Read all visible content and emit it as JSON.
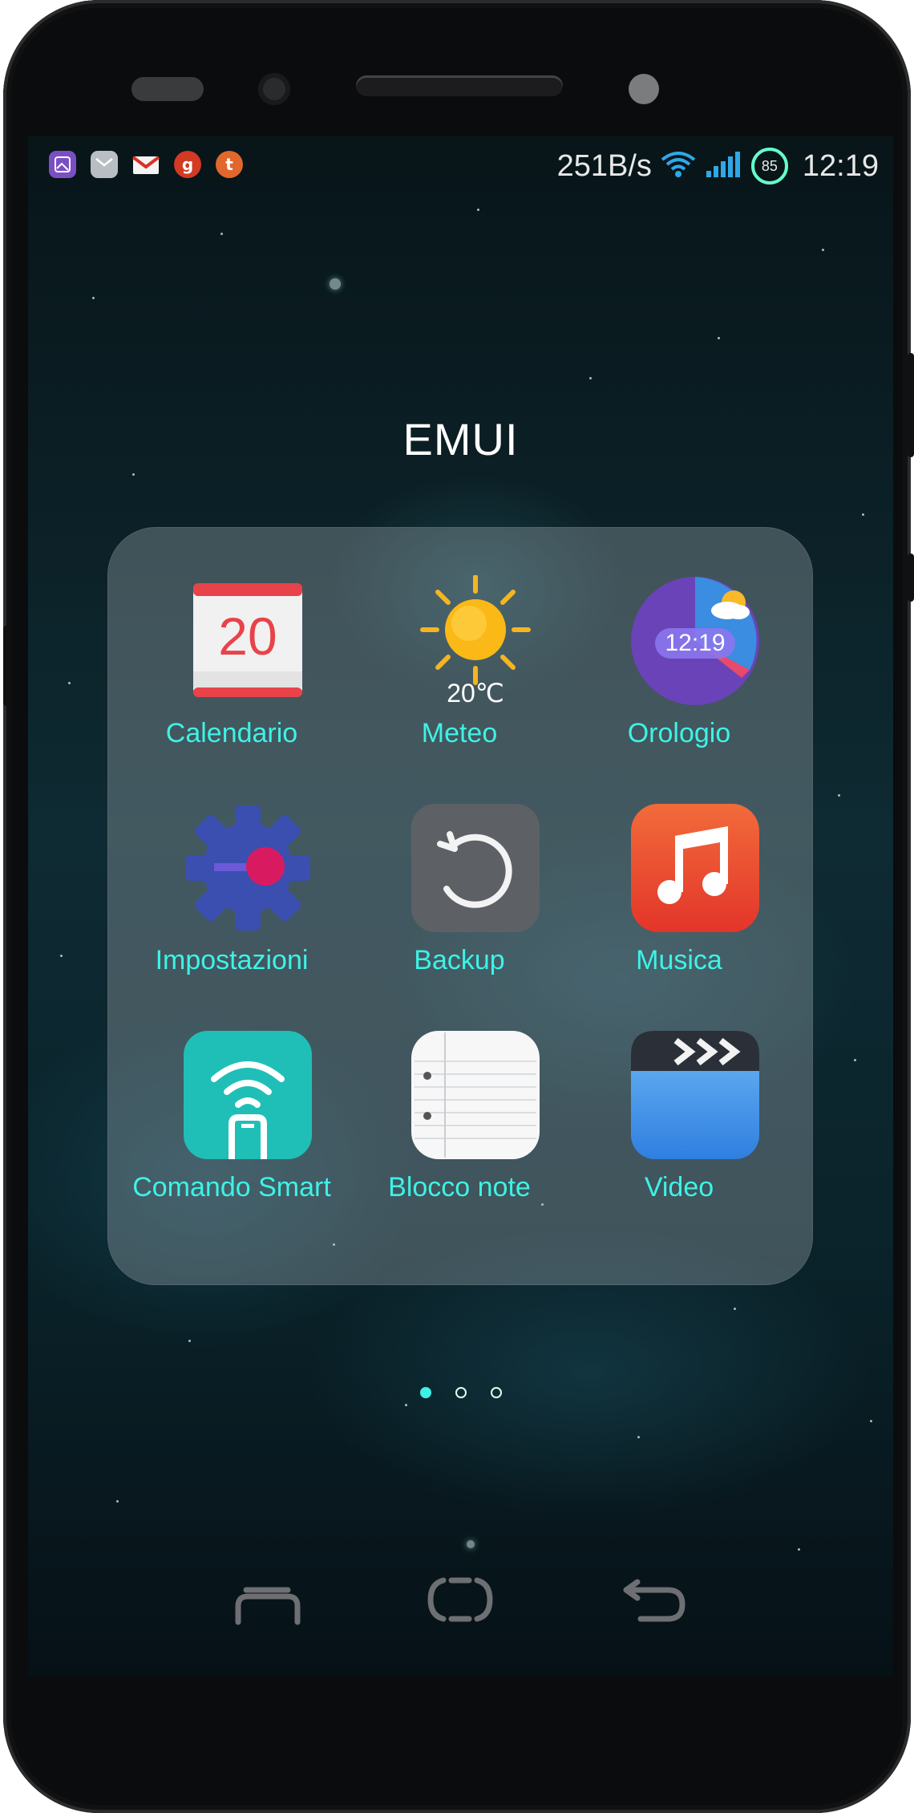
{
  "status_bar": {
    "notification_icons": [
      "gallery-icon",
      "mail-icon",
      "gmail-icon",
      "google-plus-icon",
      "tumblr-icon"
    ],
    "network_speed": "251B/s",
    "battery_level": "85",
    "time": "12:19"
  },
  "folder": {
    "title": "EMUI",
    "apps": [
      {
        "label": "Calendario",
        "icon": "calendar-icon",
        "calendar_day": "20"
      },
      {
        "label": "Meteo",
        "icon": "weather-sun-icon",
        "temperature": "20℃"
      },
      {
        "label": "Orologio",
        "icon": "clock-icon",
        "clock_time": "12:19"
      },
      {
        "label": "Impostazioni",
        "icon": "settings-gear-icon"
      },
      {
        "label": "Backup",
        "icon": "backup-icon"
      },
      {
        "label": "Musica",
        "icon": "music-note-icon"
      },
      {
        "label": "Comando Smart",
        "icon": "remote-control-icon"
      },
      {
        "label": "Blocco note",
        "icon": "notepad-icon"
      },
      {
        "label": "Video",
        "icon": "clapperboard-icon"
      }
    ],
    "pages": 3,
    "active_page": 1
  },
  "navigation": {
    "buttons": [
      "recent-apps",
      "home",
      "back"
    ]
  },
  "colors": {
    "label": "#3ef2e6",
    "calendar_red": "#e8434a",
    "clock_purple": "#6a43b8",
    "music_red": "#ef4a2b",
    "settings_blue": "#3a4fb0",
    "smart_teal": "#1fbfb8",
    "video_blue": "#3b8fe8"
  }
}
